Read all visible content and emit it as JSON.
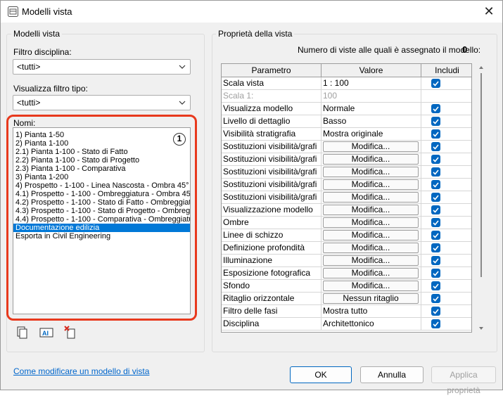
{
  "window": {
    "title": "Modelli vista"
  },
  "left": {
    "group_label": "Modelli vista",
    "filtro_disciplina_label": "Filtro disciplina:",
    "filtro_disciplina_value": "<tutti>",
    "filtro_tipo_label": "Visualizza filtro tipo:",
    "filtro_tipo_value": "<tutti>",
    "nomi_label": "Nomi:",
    "badge": "1",
    "items": [
      "1) Pianta 1-50",
      "2) Pianta 1-100",
      "2.1) Pianta 1-100 - Stato di Fatto",
      "2.2) Pianta 1-100 - Stato di Progetto",
      "2.3) Pianta 1-100 - Comparativa",
      "3) Pianta 1-200",
      "4) Prospetto - 1-100 - Linea Nascosta - Ombra 45°",
      "4.1) Prospetto - 1-100 - Ombreggiatura - Ombra 45",
      "4.2) Prospetto - 1-100 - Stato di Fatto - Ombreggiat",
      "4.3) Prospetto - 1-100 - Stato di Progetto - Ombreg",
      "4.4) Prospetto - 1-100 - Comparativa - Ombreggiatu",
      "Documentazione edilizia",
      "Esporta in Civil Engineering"
    ],
    "selected_index": 11,
    "help_link": "Come modificare un modello di vista"
  },
  "right": {
    "group_label": "Proprietà della vista",
    "count_label": "Numero di viste alle quali è assegnato il modello:",
    "count_value": "0",
    "headers": {
      "param": "Parametro",
      "value": "Valore",
      "include": "Includi"
    },
    "rows": [
      {
        "param": "Scala vista",
        "value": "1 : 100",
        "kind": "text",
        "include": true,
        "disabled": false
      },
      {
        "param": "Scala  1:",
        "value": "100",
        "kind": "text",
        "include": null,
        "disabled": true
      },
      {
        "param": "Visualizza modello",
        "value": "Normale",
        "kind": "text",
        "include": true,
        "disabled": false
      },
      {
        "param": "Livello di dettaglio",
        "value": "Basso",
        "kind": "text",
        "include": true,
        "disabled": false
      },
      {
        "param": "Visibilità stratigrafia",
        "value": "Mostra originale",
        "kind": "text",
        "include": true,
        "disabled": false
      },
      {
        "param": "Sostituzioni visibilità/grafi",
        "value": "Modifica...",
        "kind": "button",
        "include": true,
        "disabled": false
      },
      {
        "param": "Sostituzioni visibilità/grafi",
        "value": "Modifica...",
        "kind": "button",
        "include": true,
        "disabled": false
      },
      {
        "param": "Sostituzioni visibilità/grafi",
        "value": "Modifica...",
        "kind": "button",
        "include": true,
        "disabled": false
      },
      {
        "param": "Sostituzioni visibilità/grafi",
        "value": "Modifica...",
        "kind": "button",
        "include": true,
        "disabled": false
      },
      {
        "param": "Sostituzioni visibilità/grafi",
        "value": "Modifica...",
        "kind": "button",
        "include": true,
        "disabled": false
      },
      {
        "param": "Visualizzazione modello",
        "value": "Modifica...",
        "kind": "button",
        "include": true,
        "disabled": false
      },
      {
        "param": "Ombre",
        "value": "Modifica...",
        "kind": "button",
        "include": true,
        "disabled": false
      },
      {
        "param": "Linee di schizzo",
        "value": "Modifica...",
        "kind": "button",
        "include": true,
        "disabled": false
      },
      {
        "param": "Definizione profondità",
        "value": "Modifica...",
        "kind": "button",
        "include": true,
        "disabled": false
      },
      {
        "param": "Illuminazione",
        "value": "Modifica...",
        "kind": "button",
        "include": true,
        "disabled": false
      },
      {
        "param": "Esposizione fotografica",
        "value": "Modifica...",
        "kind": "button",
        "include": true,
        "disabled": false
      },
      {
        "param": "Sfondo",
        "value": "Modifica...",
        "kind": "button",
        "include": true,
        "disabled": false
      },
      {
        "param": "Ritaglio orizzontale",
        "value": "Nessun ritaglio",
        "kind": "button",
        "include": true,
        "disabled": false
      },
      {
        "param": "Filtro delle fasi",
        "value": "Mostra tutto",
        "kind": "text",
        "include": true,
        "disabled": false
      },
      {
        "param": "Disciplina",
        "value": "Architettonico",
        "kind": "text",
        "include": true,
        "disabled": false
      }
    ]
  },
  "buttons": {
    "ok": "OK",
    "cancel": "Annulla",
    "apply": "Applica proprietà"
  },
  "colors": {
    "accent": "#0067c0",
    "highlight": "#e8391d",
    "selection": "#0078d7"
  }
}
